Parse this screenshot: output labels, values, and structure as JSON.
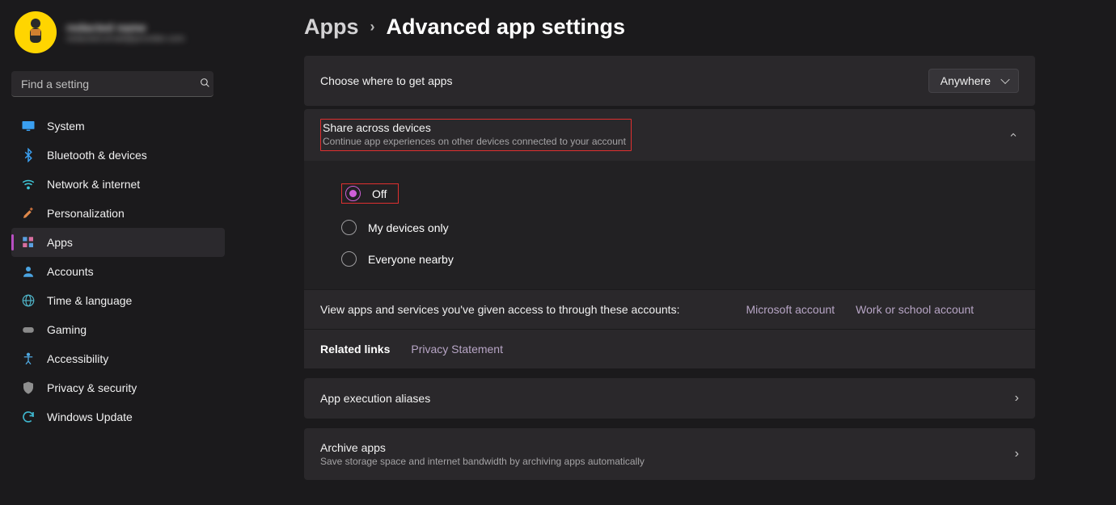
{
  "profile": {
    "name": "redacted name",
    "email": "redacted.email@provider.com"
  },
  "search": {
    "placeholder": "Find a setting"
  },
  "sidebar": {
    "items": [
      {
        "label": "System",
        "icon": "monitor"
      },
      {
        "label": "Bluetooth & devices",
        "icon": "bluetooth"
      },
      {
        "label": "Network & internet",
        "icon": "wifi"
      },
      {
        "label": "Personalization",
        "icon": "brush"
      },
      {
        "label": "Apps",
        "icon": "apps",
        "selected": true
      },
      {
        "label": "Accounts",
        "icon": "person"
      },
      {
        "label": "Time & language",
        "icon": "globe"
      },
      {
        "label": "Gaming",
        "icon": "gamepad"
      },
      {
        "label": "Accessibility",
        "icon": "accessibility"
      },
      {
        "label": "Privacy & security",
        "icon": "shield"
      },
      {
        "label": "Windows Update",
        "icon": "update"
      }
    ]
  },
  "breadcrumb": {
    "parent": "Apps",
    "current": "Advanced app settings"
  },
  "choose_apps": {
    "label": "Choose where to get apps",
    "value": "Anywhere"
  },
  "share": {
    "title": "Share across devices",
    "subtitle": "Continue app experiences on other devices connected to your account",
    "options": [
      {
        "label": "Off",
        "checked": true
      },
      {
        "label": "My devices only",
        "checked": false
      },
      {
        "label": "Everyone nearby",
        "checked": false
      }
    ]
  },
  "accounts_row": {
    "lead": "View apps and services you've given access to through these accounts:",
    "links": [
      "Microsoft account",
      "Work or school account"
    ]
  },
  "related": {
    "lead": "Related links",
    "link": "Privacy Statement"
  },
  "rows": [
    {
      "title": "App execution aliases",
      "sub": ""
    },
    {
      "title": "Archive apps",
      "sub": "Save storage space and internet bandwidth by archiving apps automatically"
    }
  ]
}
